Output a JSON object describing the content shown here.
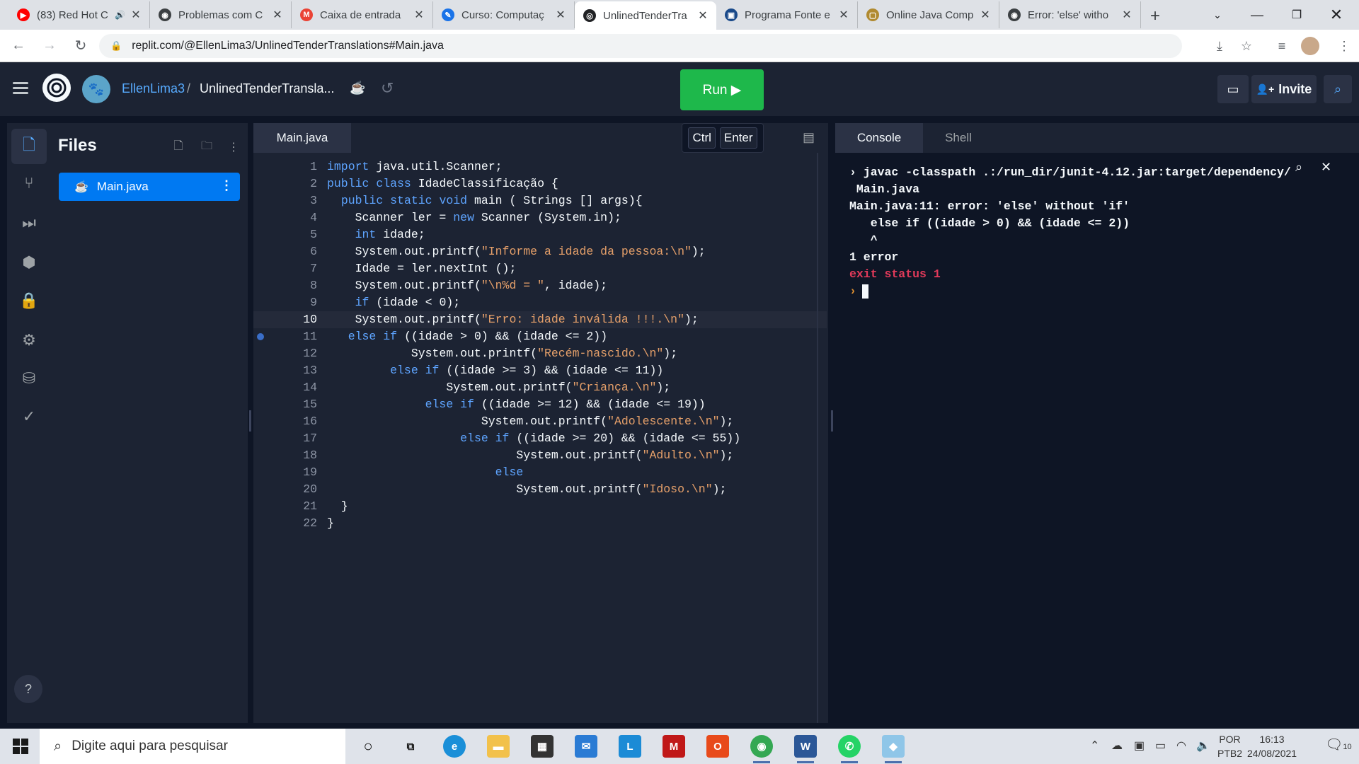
{
  "browser": {
    "tabs": [
      {
        "title": "(83) Red Hot C",
        "favicon": "youtube-icon",
        "color": "#ff0000",
        "glyph": "▶",
        "audio": true
      },
      {
        "title": "Problemas com C",
        "favicon": "replit-icon",
        "color": "#3c4043",
        "glyph": "◉"
      },
      {
        "title": "Caixa de entrada",
        "favicon": "gmail-icon",
        "color": "#ea4335",
        "glyph": "M"
      },
      {
        "title": "Curso: Computaç",
        "favicon": "course-icon",
        "color": "#1a73e8",
        "glyph": "✎"
      },
      {
        "title": "UnlinedTenderTra",
        "favicon": "replit-icon",
        "color": "#202124",
        "glyph": "◎",
        "active": true
      },
      {
        "title": "Programa Fonte e",
        "favicon": "doc-icon",
        "color": "#1a4a8a",
        "glyph": "▣"
      },
      {
        "title": "Online Java Comp",
        "favicon": "page-icon",
        "color": "#b08a30",
        "glyph": "▢"
      },
      {
        "title": "Error: 'else' witho",
        "favicon": "replit-icon",
        "color": "#3c4043",
        "glyph": "◉"
      }
    ],
    "new_tab": "+",
    "url": "replit.com/@EllenLima3/UnlinedTenderTranslations#Main.java"
  },
  "header": {
    "user": "EllenLima3",
    "separator": "/",
    "repl_name": "UnlinedTenderTransla...",
    "run_label": "Run ▶",
    "invite_label": "Invite",
    "invite_icon": "👤+"
  },
  "files": {
    "title": "Files",
    "items": [
      {
        "name": "Main.java"
      }
    ]
  },
  "editor": {
    "tab": "Main.java",
    "shortcut": {
      "key1": "Ctrl",
      "key2": "Enter"
    },
    "current_line": 10,
    "breakpoint_line": 11,
    "lines": [
      {
        "n": "1",
        "code": "import java.util.Scanner;"
      },
      {
        "n": "2",
        "code": "public class IdadeClassificação {"
      },
      {
        "n": "3",
        "code": "  public static void main ( Strings [] args){"
      },
      {
        "n": "4",
        "code": "    Scanner ler = new Scanner (System.in);"
      },
      {
        "n": "5",
        "code": "    int idade;"
      },
      {
        "n": "6",
        "code": "    System.out.printf(\"Informe a idade da pessoa:\\n\");"
      },
      {
        "n": "7",
        "code": "    Idade = ler.nextInt ();"
      },
      {
        "n": "8",
        "code": "    System.out.printf(\"\\n%d = \", idade);"
      },
      {
        "n": "9",
        "code": "    if (idade < 0);"
      },
      {
        "n": "10",
        "code": "    System.out.printf(\"Erro: idade inválida !!!.\\n\");"
      },
      {
        "n": "11",
        "code": "   else if ((idade > 0) && (idade <= 2))"
      },
      {
        "n": "12",
        "code": "            System.out.printf(\"Recém-nascido.\\n\");"
      },
      {
        "n": "13",
        "code": "         else if ((idade >= 3) && (idade <= 11))"
      },
      {
        "n": "14",
        "code": "                 System.out.printf(\"Criança.\\n\");"
      },
      {
        "n": "15",
        "code": "              else if ((idade >= 12) && (idade <= 19))"
      },
      {
        "n": "16",
        "code": "                      System.out.printf(\"Adolescente.\\n\");"
      },
      {
        "n": "17",
        "code": "                   else if ((idade >= 20) && (idade <= 55))"
      },
      {
        "n": "18",
        "code": "                           System.out.printf(\"Adulto.\\n\");"
      },
      {
        "n": "19",
        "code": "                        else"
      },
      {
        "n": "20",
        "code": "                           System.out.printf(\"Idoso.\\n\");"
      },
      {
        "n": "21",
        "code": "  }"
      },
      {
        "n": "22",
        "code": "}"
      }
    ]
  },
  "console": {
    "tabs": [
      "Console",
      "Shell"
    ],
    "lines": [
      {
        "text": "› javac -classpath .:/run_dir/junit-4.12.jar:target/dependency/",
        "style": "normal"
      },
      {
        "text": " Main.java",
        "style": "normal"
      },
      {
        "text": "Main.java:11: error: 'else' without 'if'",
        "style": "normal"
      },
      {
        "text": "   else if ((idade > 0) && (idade <= 2))",
        "style": "normal"
      },
      {
        "text": "   ^",
        "style": "normal"
      },
      {
        "text": "1 error",
        "style": "normal"
      },
      {
        "text": "exit status 1",
        "style": "red"
      }
    ],
    "prompt": "›"
  },
  "taskbar": {
    "search_placeholder": "Digite aqui para pesquisar",
    "lang_top": "POR",
    "lang_bottom": "PTB2",
    "time": "16:13",
    "date": "24/08/2021",
    "notif_count": "10"
  },
  "colors": {
    "run_green": "#1eb84b",
    "accent_blue": "#0079f2",
    "keyword": "#5ea4ff",
    "string": "#e6a06a",
    "error_red": "#e23a5a"
  }
}
